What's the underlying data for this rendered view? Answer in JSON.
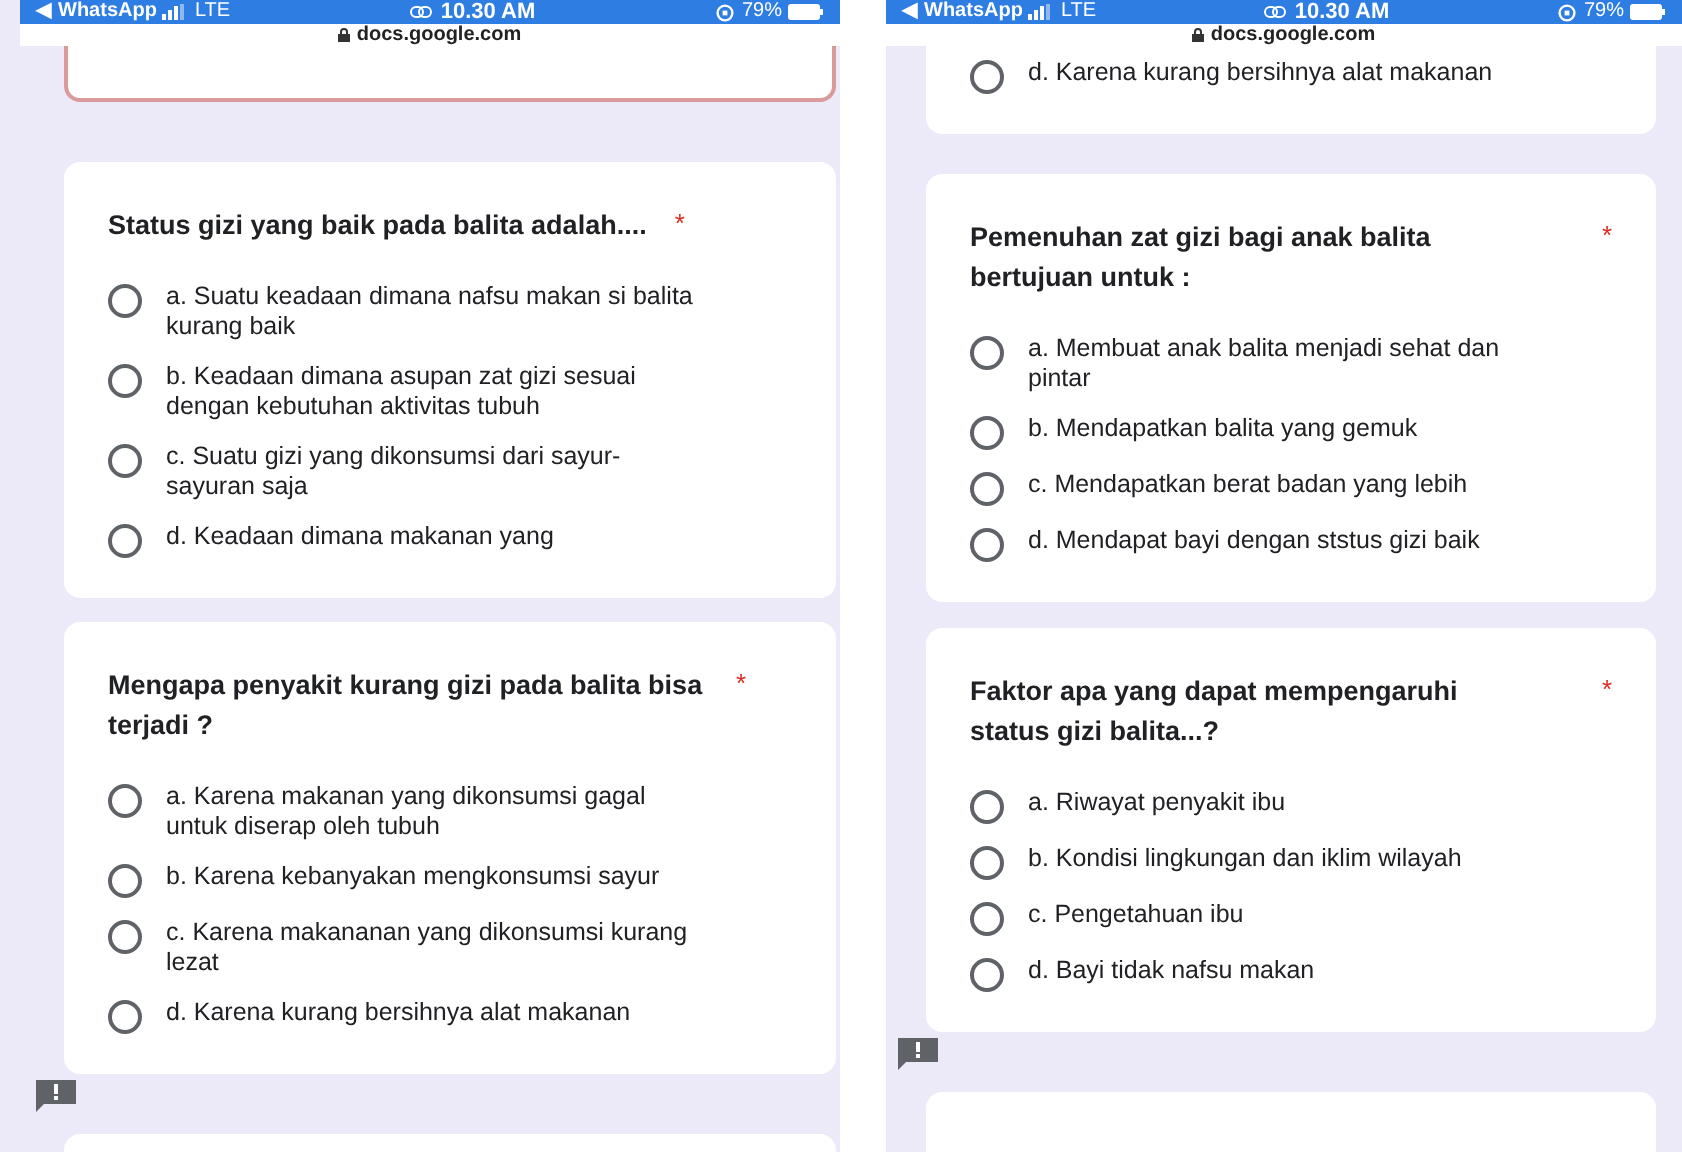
{
  "phones": [
    {
      "status_bar": {
        "back": "◀",
        "app": "WhatsApp",
        "network": "LTE",
        "time": "10.30 AM",
        "battery": "79%"
      },
      "url": "docs.google.com",
      "top_card": {
        "error": true
      },
      "questions": [
        {
          "title": "Status gizi yang baik pada balita adalah....",
          "required_mark": "*",
          "options": [
            {
              "label": "a. Suatu keadaan dimana nafsu makan si balita kurang baik",
              "selected": false
            },
            {
              "label": "b. Keadaan dimana asupan zat gizi sesuai dengan kebutuhan aktivitas tubuh",
              "selected": false
            },
            {
              "label": "c. Suatu gizi yang dikonsumsi dari sayur-sayuran saja",
              "selected": false
            },
            {
              "label": "d. Keadaan dimana makanan yang",
              "selected": false
            }
          ]
        },
        {
          "title": "Mengapa penyakit kurang gizi pada balita bisa terjadi ?",
          "required_mark": "*",
          "options": [
            {
              "label": "a. Karena makanan yang dikonsumsi gagal untuk diserap oleh tubuh",
              "selected": false
            },
            {
              "label": "b. Karena kebanyakan mengkonsumsi sayur",
              "selected": false
            },
            {
              "label": "c. Karena makananan yang dikonsumsi kurang lezat",
              "selected": false
            },
            {
              "label": "d. Karena kurang bersihnya alat makanan",
              "selected": false
            }
          ]
        }
      ]
    },
    {
      "status_bar": {
        "back": "◀",
        "app": "WhatsApp",
        "network": "LTE",
        "time": "10.30 AM",
        "battery": "79%"
      },
      "url": "docs.google.com",
      "top_card": {
        "error": false,
        "options": [
          {
            "label": "d. Karena kurang bersihnya alat makanan",
            "selected": false
          }
        ]
      },
      "questions": [
        {
          "title": "Pemenuhan zat gizi bagi anak balita bertujuan untuk :",
          "required_mark": "*",
          "options": [
            {
              "label": "a. Membuat anak balita menjadi sehat dan pintar",
              "selected": false
            },
            {
              "label": "b. Mendapatkan balita yang gemuk",
              "selected": false
            },
            {
              "label": "c. Mendapatkan berat badan yang lebih",
              "selected": false
            },
            {
              "label": "d. Mendapat bayi dengan ststus gizi baik",
              "selected": false
            }
          ]
        },
        {
          "title": "Faktor apa yang dapat mempengaruhi status gizi balita...?",
          "required_mark": "*",
          "options": [
            {
              "label": "a. Riwayat penyakit ibu",
              "selected": false
            },
            {
              "label": "b. Kondisi lingkungan dan iklim wilayah",
              "selected": false
            },
            {
              "label": "c. Pengetahuan ibu",
              "selected": false
            },
            {
              "label": "d. Bayi tidak nafsu makan",
              "selected": false
            }
          ]
        }
      ]
    }
  ]
}
